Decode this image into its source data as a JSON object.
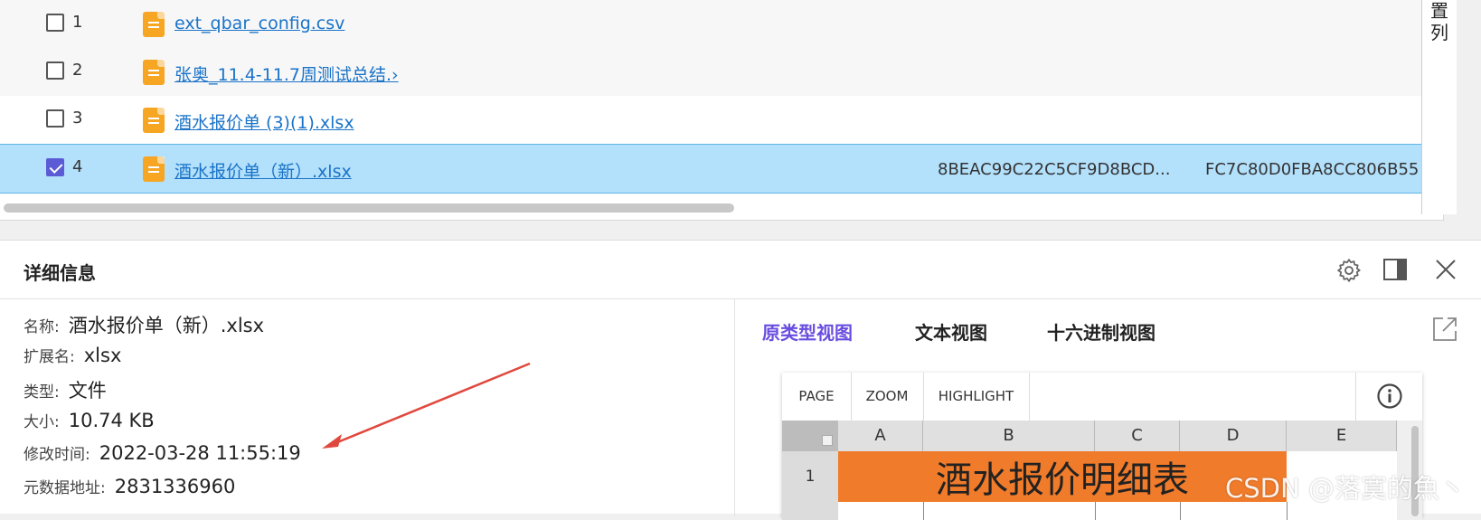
{
  "file_table": {
    "rows": [
      {
        "index": "1",
        "name": "ext_qbar_config.csv",
        "checked": false
      },
      {
        "index": "2",
        "name": "张奥_11.4-11.7周测试总结.›",
        "checked": false
      },
      {
        "index": "3",
        "name": "酒水报价单 (3)(1).xlsx",
        "checked": false
      },
      {
        "index": "4",
        "name": "酒水报价单（新）.xlsx",
        "checked": true,
        "hash1": "8BEAC99C22C5CF9D8BCD...",
        "hash2": "FC7C80D0FBA8CC806B55"
      }
    ],
    "side_label": "置\n列"
  },
  "detail": {
    "title": "详细信息",
    "props": {
      "name_label": "名称:",
      "name_value": "酒水报价单（新）.xlsx",
      "ext_label": "扩展名:",
      "ext_value": "xlsx",
      "type_label": "类型:",
      "type_value": "文件",
      "size_label": "大小:",
      "size_value": "10.74 KB",
      "mtime_label": "修改时间:",
      "mtime_value": "2022-03-28 11:55:19",
      "addr_label": "元数据地址:",
      "addr_value": "2831336960"
    },
    "tabs": [
      "原类型视图",
      "文本视图",
      "十六进制视图"
    ],
    "viewer": {
      "buttons": [
        "PAGE",
        "ZOOM",
        "HIGHLIGHT"
      ],
      "columns": [
        "A",
        "B",
        "C",
        "D",
        "E"
      ],
      "row_numbers": [
        "1"
      ],
      "merged_title": "酒水报价明细表"
    }
  },
  "watermark": "CSDN @落寞的魚丶",
  "colors": {
    "selected_row": "#b3e0fb",
    "link": "#1a73c8",
    "active_tab": "#6a4de0",
    "accent_orange": "#f07b2a",
    "file_icon": "#f6a623",
    "arrow": "#e0483e"
  },
  "icons": [
    "file-icon",
    "gear-icon",
    "split-view-icon",
    "close-icon",
    "external-link-icon",
    "info-icon"
  ]
}
